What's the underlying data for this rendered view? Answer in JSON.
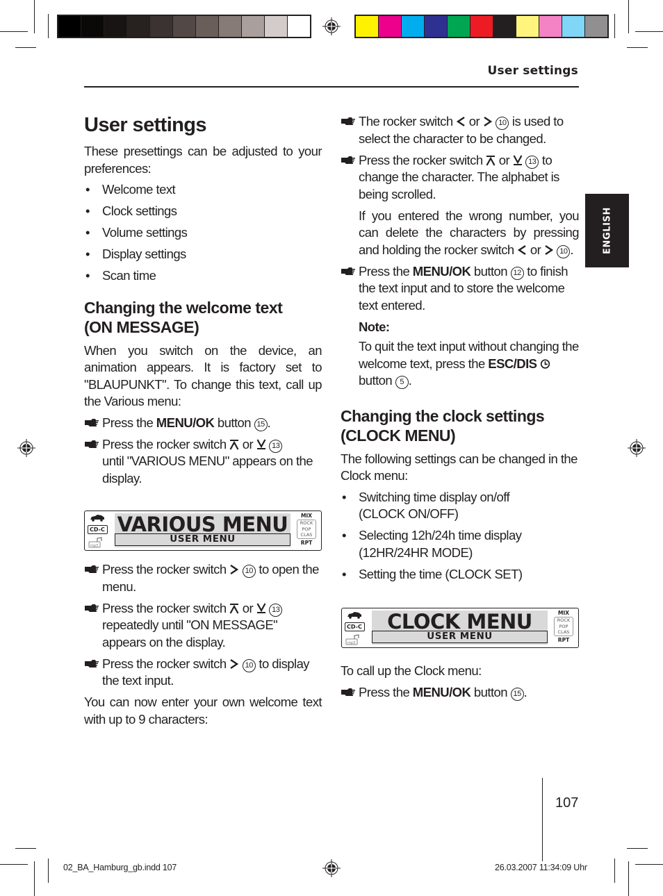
{
  "colors": {
    "gray_swatches": [
      "#000000",
      "#0b0908",
      "#171413",
      "#27211f",
      "#3b3331",
      "#524845",
      "#6a5e5b",
      "#877b77",
      "#a99f9c",
      "#d4cccb",
      "#ffffff"
    ],
    "color_swatches": [
      "#fff200",
      "#ec008c",
      "#00aeef",
      "#2e3192",
      "#00a651",
      "#ed1c24",
      "#231f20",
      "#fff57d",
      "#f383c4",
      "#7fd6f7",
      "#918f90"
    ],
    "ink": "#231f20",
    "lcd_bg": "#d9d9d9"
  },
  "header": {
    "running_head": "User settings",
    "language_tab": "ENGLISH"
  },
  "left": {
    "title": "User settings",
    "intro": "These presettings can be adjusted to your preferences:",
    "bullets": [
      "Welcome text",
      "Clock settings",
      "Volume settings",
      "Display settings",
      "Scan time"
    ],
    "section_title_line1": "Changing the welcome text",
    "section_title_line2": "(ON MESSAGE)",
    "section_intro": "When you switch on the device, an animation appears. It is factory set to \"BLAUPUNKT\". To change this text, call up the Various menu:",
    "steps": [
      {
        "pre": "Press the ",
        "bold": "MENU/OK",
        "post": " button ",
        "num": "15",
        "end": "."
      },
      {
        "pre": "Press the rocker switch ",
        "mid": " or ",
        "num": "13",
        "post": " until \"VARIOUS MENU\" appears on the display."
      }
    ],
    "display": {
      "main": "VARIOUS MENU",
      "sub": "USER MENU",
      "cd": "CD-C",
      "mix": "MIX",
      "modes": [
        "ROCK",
        "POP",
        "CLAS"
      ],
      "rpt": "RPT"
    },
    "steps2": [
      {
        "pre": "Press the rocker switch ",
        "num": "10",
        "post": " to open the menu."
      },
      {
        "pre": "Press the rocker switch ",
        "mid": " or ",
        "num": "13",
        "post": " repeatedly until \"ON MESSAGE\" appears on the display."
      },
      {
        "pre": "Press the rocker switch ",
        "num": "10",
        "post": " to display the text input."
      }
    ],
    "outro": "You can now enter your own welcome text with up to 9 characters:"
  },
  "right": {
    "steps": [
      {
        "pre": "The rocker switch ",
        "mid": " or ",
        "num": "10",
        "post": " is used to select the character to be changed."
      },
      {
        "pre": "Press the rocker switch ",
        "mid": " or ",
        "num": "13",
        "post": " to change the character. The alphabet is being scrolled.",
        "extra_pre": "If you entered the wrong number, you can delete the characters by pressing and holding the rocker switch ",
        "extra_mid": " or ",
        "extra_num": "10",
        "extra_end": "."
      },
      {
        "pre": "Press the ",
        "bold": "MENU/OK",
        "post": " button ",
        "num": "12",
        "post2": " to finish the text input and to store the welcome text entered."
      }
    ],
    "note_label": "Note:",
    "note_pre": "To quit the text input without changing the welcome text, press the ",
    "note_bold": "ESC/DIS",
    "note_post": " button ",
    "note_num": "5",
    "note_end": ".",
    "section_title_line1": "Changing the clock settings",
    "section_title_line2": "(CLOCK MENU)",
    "section_intro": "The following settings can be changed in the Clock menu:",
    "bullets": [
      {
        "line1": "Switching time display on/off",
        "line2": "(CLOCK ON/OFF)"
      },
      {
        "line1": "Selecting 12h/24h time display",
        "line2": "(12HR/24HR MODE)"
      },
      {
        "line1": "Setting the time (CLOCK SET)",
        "line2": ""
      }
    ],
    "display": {
      "main": "CLOCK MENU",
      "sub": "USER MENU",
      "cd": "CD-C",
      "mix": "MIX",
      "modes": [
        "ROCK",
        "POP",
        "CLAS"
      ],
      "rpt": "RPT"
    },
    "call_up": "To call up the Clock menu:",
    "final_step": {
      "pre": "Press the ",
      "bold": "MENU/OK",
      "post": " button ",
      "num": "15",
      "end": "."
    }
  },
  "footer": {
    "page_number": "107",
    "slug_file": "02_BA_Hamburg_gb.indd   107",
    "slug_date": "26.03.2007   11:34:09 Uhr"
  }
}
